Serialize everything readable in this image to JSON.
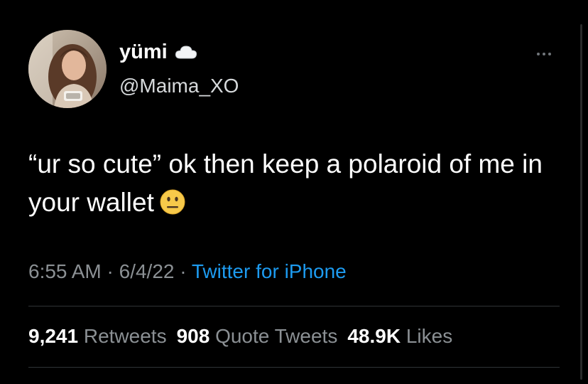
{
  "author": {
    "display_name": "yümi",
    "handle": "@Maima_XO",
    "badge_icon": "cloud-icon",
    "avatar": "avatar-photo"
  },
  "menu": {
    "icon": "more-icon"
  },
  "tweet": {
    "text": "“ur so cute” ok then keep a polaroid of me in your wallet",
    "emoji": "neutral-face-emoji"
  },
  "meta": {
    "time": "6:55 AM",
    "separator1": " · ",
    "date": "6/4/22",
    "separator2": " · ",
    "source": "Twitter for iPhone"
  },
  "stats": {
    "retweets_count": "9,241",
    "retweets_label": "Retweets",
    "quotes_count": "908",
    "quotes_label": "Quote Tweets",
    "likes_count": "48.9K",
    "likes_label": "Likes"
  },
  "colors": {
    "background": "#000000",
    "text": "#ffffff",
    "secondary": "#8b9094",
    "link": "#1d9bf0",
    "divider": "#2f3336"
  }
}
